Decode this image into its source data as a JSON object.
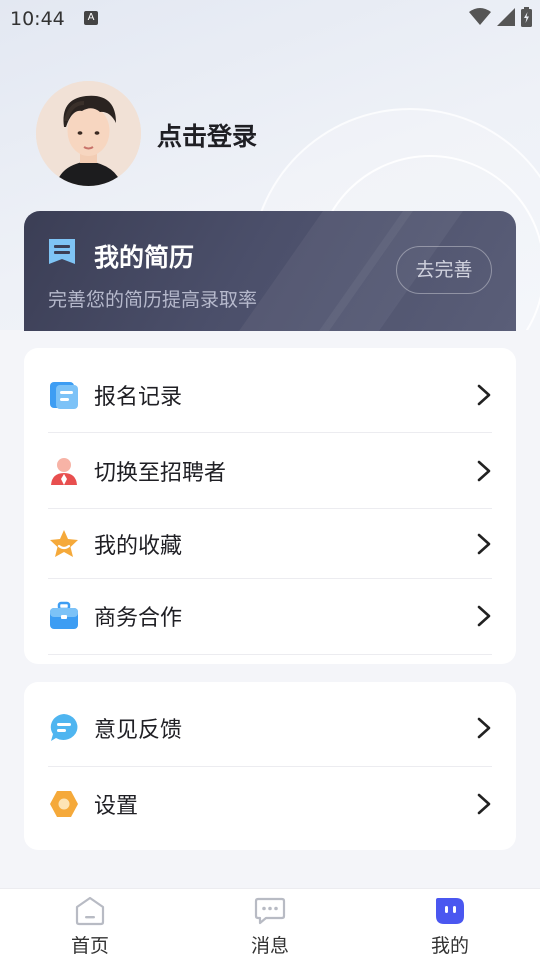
{
  "status_bar": {
    "time": "10:44",
    "notification_letter": "A"
  },
  "profile": {
    "login_text": "点击登录"
  },
  "resume": {
    "title": "我的简历",
    "subtitle": "完善您的简历提高录取率",
    "button_label": "去完善"
  },
  "menu_main": [
    {
      "label": "报名记录",
      "icon": "document-list-icon",
      "color": "#3d9df3"
    },
    {
      "label": "切换至招聘者",
      "icon": "recruiter-person-icon",
      "color": "#f07a6e"
    },
    {
      "label": "我的收藏",
      "icon": "star-icon",
      "color": "#f5a93a"
    },
    {
      "label": "商务合作",
      "icon": "briefcase-icon",
      "color": "#3d9df3"
    }
  ],
  "menu_secondary": [
    {
      "label": "意见反馈",
      "icon": "feedback-bubble-icon",
      "color": "#4fb5f0"
    },
    {
      "label": "设置",
      "icon": "settings-hexagon-icon",
      "color": "#f5a93a"
    }
  ],
  "bottom_nav": [
    {
      "label": "首页",
      "icon": "home-icon",
      "active": false
    },
    {
      "label": "消息",
      "icon": "message-icon",
      "active": false
    },
    {
      "label": "我的",
      "icon": "profile-robot-icon",
      "active": true
    }
  ],
  "colors": {
    "accent": "#4a57f0",
    "card_dark": "#3b3e55",
    "page_bg": "#f4f5f9"
  }
}
